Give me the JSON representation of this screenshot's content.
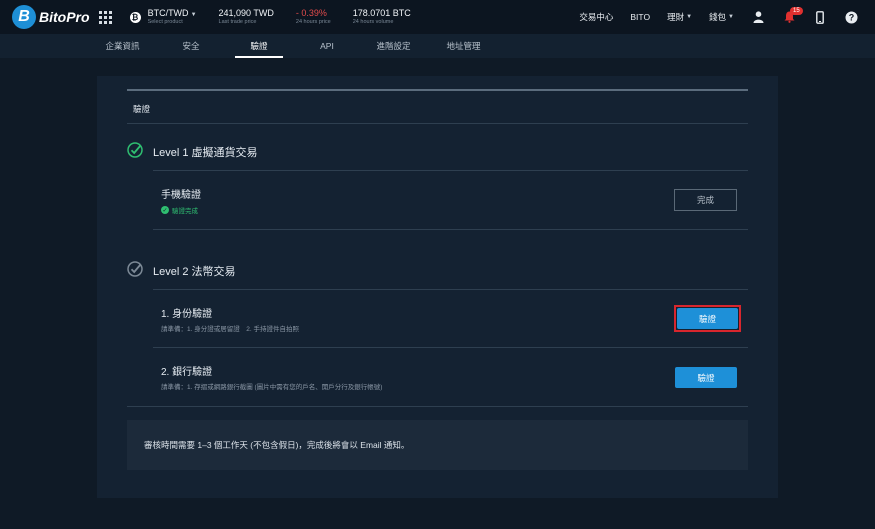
{
  "brand": {
    "logo_letter": "B",
    "name": "BitoPro"
  },
  "ticker": {
    "pair": "BTC/TWD",
    "pair_sub": "Select product",
    "price": "241,090 TWD",
    "price_sub": "Last trade price",
    "change": "- 0.39%",
    "change_sub": "24 hours price",
    "volume": "178.0701 BTC",
    "volume_sub": "24 hours volume"
  },
  "topnav": {
    "exchange": "交易中心",
    "bito": "BITO",
    "finance": "理財",
    "wallet": "錢包",
    "notification_count": "15"
  },
  "tabs": [
    {
      "label": "企業資訊"
    },
    {
      "label": "安全"
    },
    {
      "label": "驗證",
      "active": true
    },
    {
      "label": "API"
    },
    {
      "label": "進階設定"
    },
    {
      "label": "地址管理"
    }
  ],
  "page": {
    "section_title": "驗證",
    "level1": {
      "title": "Level 1 虛擬通貨交易",
      "item_title": "手機驗證",
      "item_status": "驗證完成",
      "button": "完成"
    },
    "level2": {
      "title": "Level 2 法幣交易",
      "identity_title": "1. 身份驗證",
      "identity_sub": "請準備：1. 身分證或居留證　2. 手持證件自拍照",
      "identity_button": "驗證",
      "bank_title": "2. 銀行驗證",
      "bank_sub": "請準備：1. 存摺或網路銀行截圖 (圖片中需有您的戶名、開戶分行及銀行帳號)",
      "bank_button": "驗證"
    },
    "notice": "審核時間需要 1–3 個工作天 (不包含假日)，完成後將會以 Email 通知。"
  },
  "colors": {
    "accent": "#1e90d8",
    "success": "#2fbf71",
    "negative": "#e24b4b",
    "highlight": "#d8262d"
  }
}
